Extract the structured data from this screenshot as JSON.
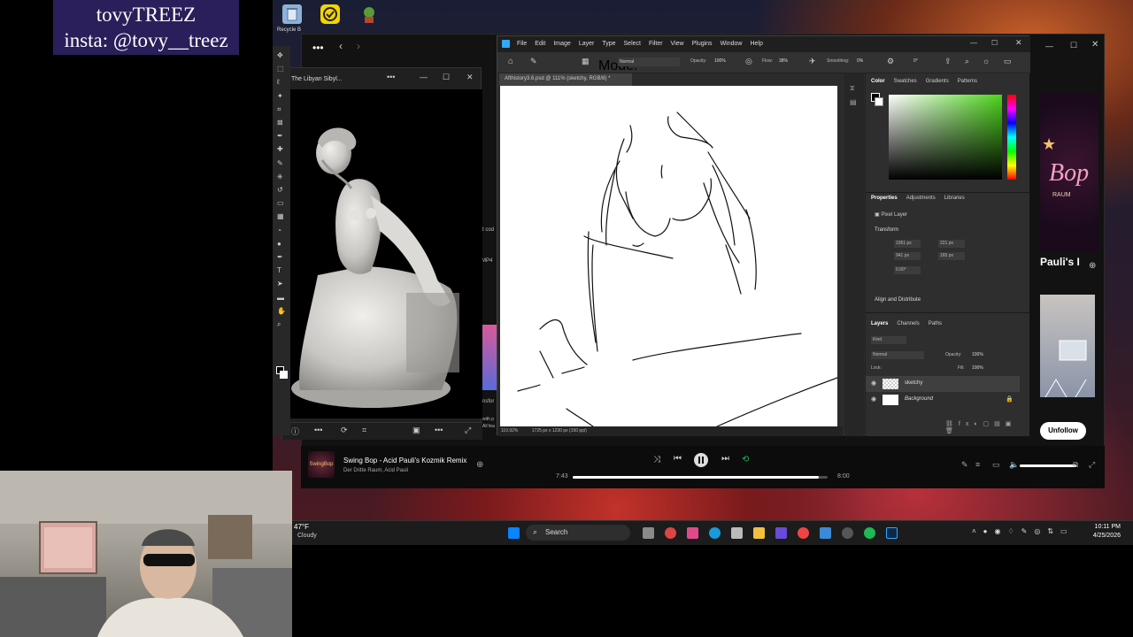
{
  "overlay": {
    "line1": "tovyTREEZ",
    "line2": "insta: @tovy__treez"
  },
  "desktop": {
    "recycle_label": "Recycle B"
  },
  "viewer": {
    "title": "The Libyan Sibyl..."
  },
  "spotify": {
    "track_title": "Swing Bop - Acid Pauli's Kozmik Remix",
    "track_artist": "Der Dritte Raum, Acid Pauli",
    "elapsed": "7:43",
    "duration": "8:00",
    "progress_fraction": 0.965,
    "unfollow_label": "Unfollow",
    "side_snippets": [
      "t cod",
      "MP4",
      "nsfor",
      "with p",
      "All fea"
    ],
    "artist_tile": "Pauli's I",
    "cover_text": "Bop",
    "cover_sub": "RAUM"
  },
  "photoshop": {
    "menu": [
      "File",
      "Edit",
      "Image",
      "Layer",
      "Type",
      "Select",
      "Filter",
      "View",
      "Plugins",
      "Window",
      "Help"
    ],
    "options": {
      "mode_label": "Mode:",
      "mode_value": "Normal",
      "opacity_label": "Opacity:",
      "opacity_value": "100%",
      "flow_label": "Flow:",
      "flow_value": "38%",
      "smoothing_label": "Smoothing:",
      "smoothing_value": "0%",
      "angle": "0°"
    },
    "doc_tab": "Afthistory3.6.psd @ 111% (sketchy, RGB/8) *",
    "status": {
      "zoom": "110.92%",
      "size": "1725 px x 1230 px (150 ppi)"
    },
    "color_panel_tabs": [
      "Color",
      "Swatches",
      "Gradients",
      "Patterns"
    ],
    "props_tabs": [
      "Properties",
      "Adjustments",
      "Libraries"
    ],
    "props": {
      "kind": "Pixel Layer",
      "section": "Transform",
      "w": "1051 px",
      "h": "941 px",
      "x": "221 px",
      "y": "165 px",
      "angle": "0.00°",
      "align": "Align and Distribute"
    },
    "layers_tabs": [
      "Layers",
      "Channels",
      "Paths"
    ],
    "layers_controls": {
      "kind": "Kind",
      "blend": "Normal",
      "opacity_label": "Opacity:",
      "opacity_value": "100%",
      "lock_label": "Lock:",
      "fill_label": "Fill:",
      "fill_value": "100%"
    },
    "layers": [
      {
        "name": "sketchy"
      },
      {
        "name": "Background"
      }
    ]
  },
  "taskbar": {
    "weather_temp": "47°F",
    "weather_desc": "Cloudy",
    "search_label": "Search",
    "time": "10:11 PM",
    "date": "4/25/2026"
  },
  "colors": {
    "ps_bg": "#2b2b2b",
    "spotify_green": "#1db954",
    "overlay_bg": "#2a1f5a",
    "accent_blue": "#0a84ff"
  }
}
